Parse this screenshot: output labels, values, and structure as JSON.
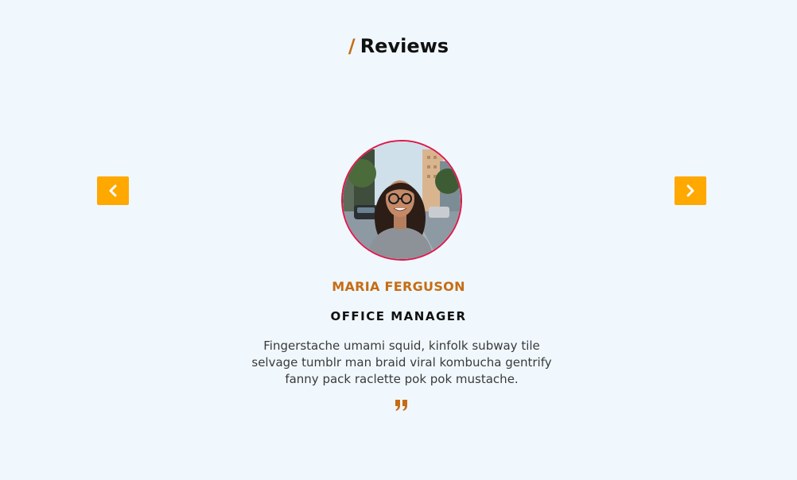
{
  "section": {
    "slash": "/",
    "title": "Reviews"
  },
  "carousel": {
    "prev_icon": "chevron-left-icon",
    "next_icon": "chevron-right-icon",
    "accent_color": "#ffa800"
  },
  "review": {
    "name": "MARIA FERGUSON",
    "role": "OFFICE MANAGER",
    "text": "Fingerstache umami squid, kinfolk subway tile selvage tumblr man braid viral kombucha gentrify fanny pack raclette pok pok mustache.",
    "quote_icon": "quote-icon"
  },
  "colors": {
    "background": "#f0f8fd",
    "name": "#c76c14",
    "avatar_border": "#e0174a"
  }
}
